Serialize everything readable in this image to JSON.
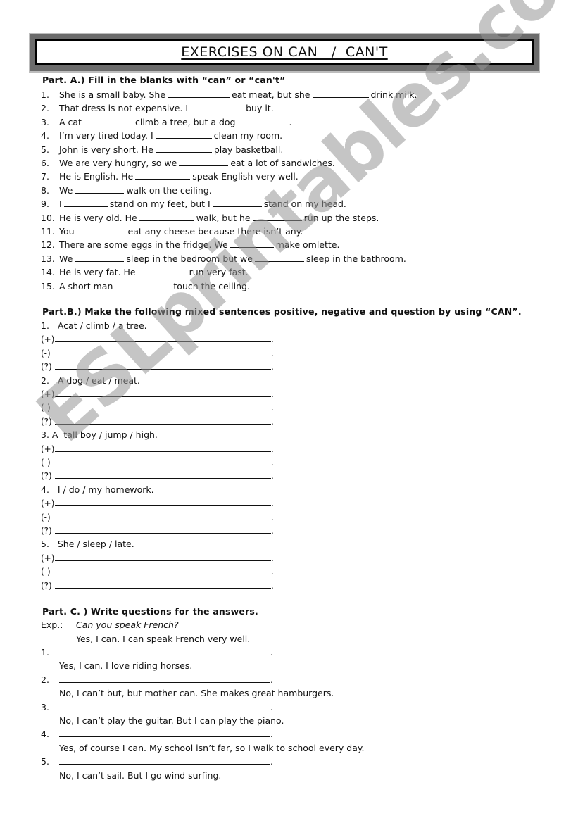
{
  "title": "EXERCISES ON CAN   /  CAN'T",
  "watermark": "ESLprintables.com",
  "partA": {
    "heading": "Part.  A.) Fill in the blanks with “can” or “can't”",
    "items": [
      {
        "num": "1.",
        "segments": [
          "She is a small baby. She",
          "eat meat, but she",
          "drink milk."
        ]
      },
      {
        "num": "2.",
        "segments": [
          "That dress is not expensive. I",
          "buy it."
        ]
      },
      {
        "num": "3.",
        "segments": [
          "A cat",
          "climb a tree, but a dog",
          "."
        ]
      },
      {
        "num": "4.",
        "segments": [
          "I’m very tired today. I",
          "clean my room."
        ]
      },
      {
        "num": "5.",
        "segments": [
          "John is very short. He",
          "play basketball."
        ]
      },
      {
        "num": "6.",
        "segments": [
          "We are very hungry, so we",
          "eat a lot of sandwiches."
        ]
      },
      {
        "num": "7.",
        "segments": [
          "He is English. He",
          "speak English very well."
        ]
      },
      {
        "num": "8.",
        "segments": [
          "We",
          "walk on the ceiling."
        ]
      },
      {
        "num": "9.",
        "segments": [
          "I",
          "stand on my feet, but I",
          "stand on my head."
        ]
      },
      {
        "num": "10.",
        "segments": [
          "He is very old. He",
          "walk, but he",
          "run up the steps."
        ]
      },
      {
        "num": "11.",
        "segments": [
          "You",
          "eat any cheese because there isn’t any."
        ]
      },
      {
        "num": "12.",
        "segments": [
          "There are some eggs in the fridge. We",
          "make omlette."
        ]
      },
      {
        "num": "13.",
        "segments": [
          "We",
          "sleep in the bedroom but we",
          "sleep in the bathroom."
        ]
      },
      {
        "num": "14.",
        "segments": [
          "He is very fat. He",
          "run very fast."
        ]
      },
      {
        "num": "15.",
        "segments": [
          "A short man",
          "touch the ceiling."
        ]
      }
    ]
  },
  "partB": {
    "heading": "Part.B.) Make the following mixed sentences positive, negative and question by using “CAN”.",
    "symbols": [
      "(+)",
      "(-)",
      "(?)"
    ],
    "line_end": ".",
    "items": [
      {
        "prompt": "1.   Acat / climb / a tree."
      },
      {
        "prompt": "2.   A dog / eat / meat."
      },
      {
        "prompt": "3. A  tall boy / jump / high."
      },
      {
        "prompt": "4.   I / do / my homework."
      },
      {
        "prompt": "5.   She / sleep / late."
      }
    ]
  },
  "partC": {
    "heading": "Part. C. ) Write questions for the answers.",
    "example_label": "Exp.:",
    "example_question": "Can you speak French?",
    "example_answer": "Yes, I can. I can speak French very well.",
    "line_end": ".",
    "items": [
      {
        "num": "1.",
        "answer": "Yes, I can. I love riding horses."
      },
      {
        "num": "2.",
        "answer": "No, I can’t but, but mother can. She makes great hamburgers."
      },
      {
        "num": "3.",
        "answer": "No, I can’t play the guitar. But I can play the piano."
      },
      {
        "num": "4.",
        "answer": "Yes, of course I can. My school isn’t far, so I walk to school every day."
      },
      {
        "num": "5.",
        "answer": "No, I can’t sail. But I go wind surfing."
      }
    ]
  }
}
